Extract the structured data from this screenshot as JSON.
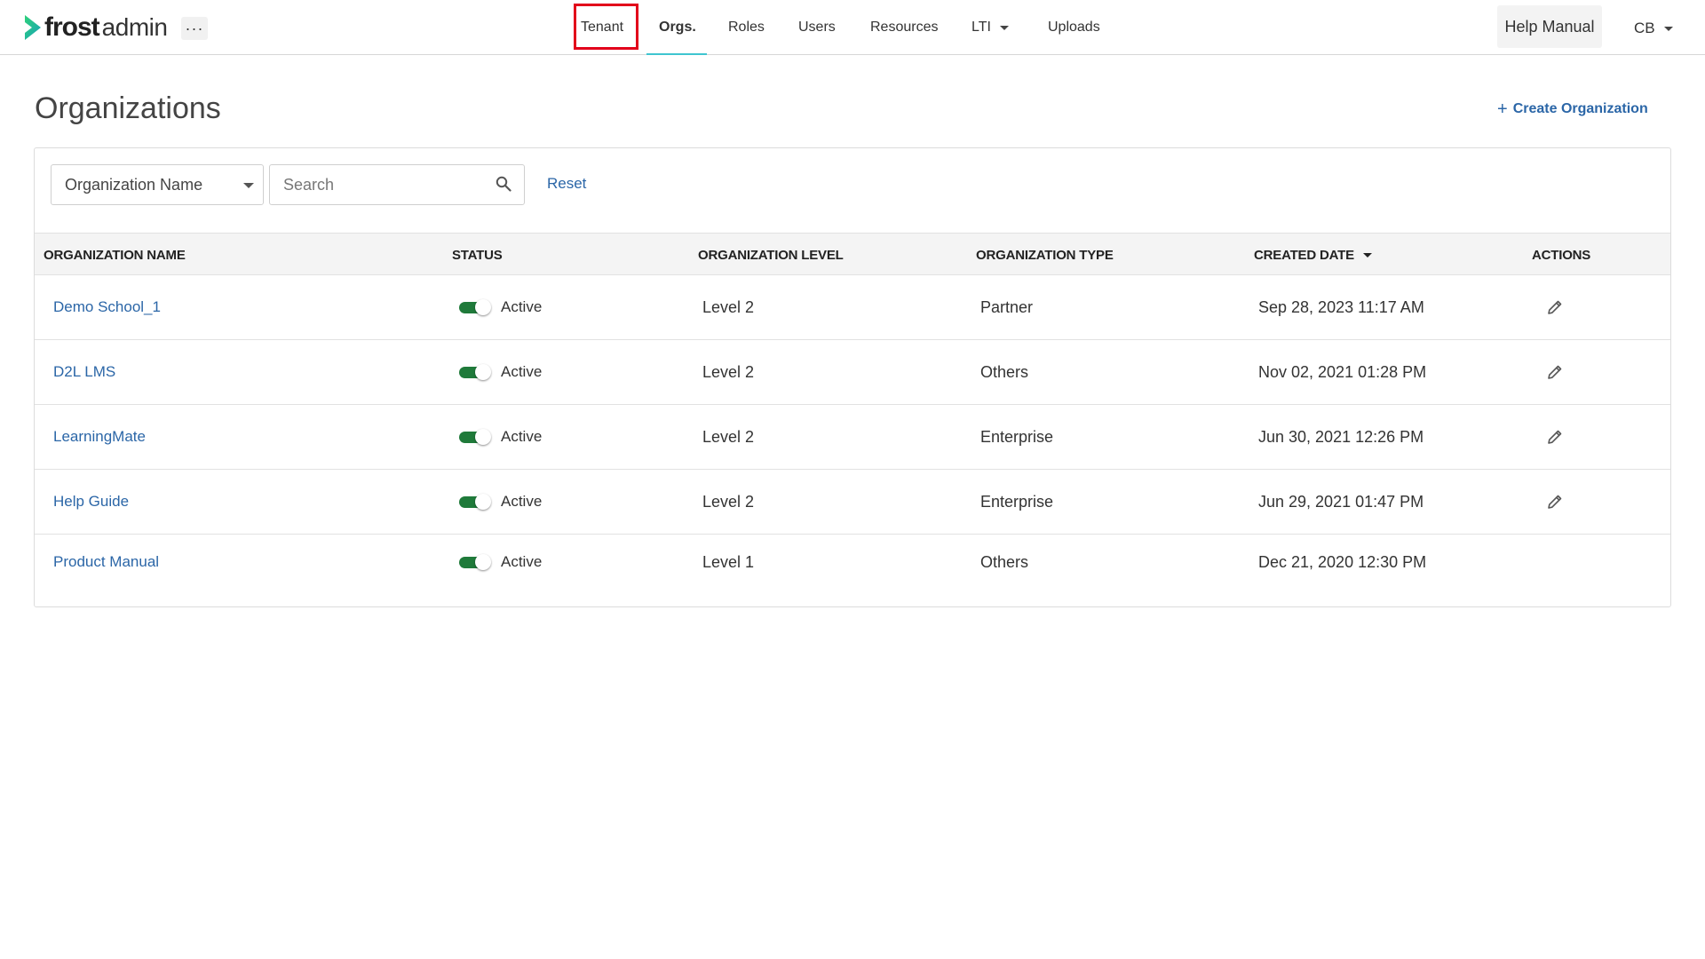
{
  "app": {
    "logo_word": "frost",
    "logo_sub": "admin",
    "more_label": "···"
  },
  "nav": {
    "items": [
      {
        "label": "Tenant"
      },
      {
        "label": "Orgs."
      },
      {
        "label": "Roles"
      },
      {
        "label": "Users"
      },
      {
        "label": "Resources"
      },
      {
        "label": "LTI"
      },
      {
        "label": "Uploads"
      }
    ],
    "active": "Orgs."
  },
  "header_right": {
    "help_label": "Help Manual",
    "user_initials": "CB"
  },
  "page": {
    "title": "Organizations",
    "create_label": "Create Organization"
  },
  "filters": {
    "field_selected": "Organization Name",
    "search_placeholder": "Search",
    "reset_label": "Reset"
  },
  "table": {
    "columns": {
      "name": "ORGANIZATION NAME",
      "status": "STATUS",
      "level": "ORGANIZATION LEVEL",
      "type": "ORGANIZATION TYPE",
      "created": "CREATED DATE",
      "actions": "ACTIONS"
    },
    "sort": {
      "column": "CREATED DATE",
      "direction": "descending"
    },
    "rows": [
      {
        "name": "Demo School_1",
        "status": "Active",
        "enabled": true,
        "level": "Level 2",
        "type": "Partner",
        "created": "Sep 28, 2023 11:17 AM",
        "editable": true
      },
      {
        "name": "D2L LMS",
        "status": "Active",
        "enabled": true,
        "level": "Level 2",
        "type": "Others",
        "created": "Nov 02, 2021 01:28 PM",
        "editable": true
      },
      {
        "name": "LearningMate",
        "status": "Active",
        "enabled": true,
        "level": "Level 2",
        "type": "Enterprise",
        "created": "Jun 30, 2021 12:26 PM",
        "editable": true
      },
      {
        "name": "Help Guide",
        "status": "Active",
        "enabled": true,
        "level": "Level 2",
        "type": "Enterprise",
        "created": "Jun 29, 2021 01:47 PM",
        "editable": true
      },
      {
        "name": "Product Manual",
        "status": "Active",
        "enabled": true,
        "level": "Level 1",
        "type": "Others",
        "created": "Dec 21, 2020 12:30 PM",
        "editable": false
      }
    ]
  },
  "colors": {
    "brand_green": "#1fb25a",
    "brand_teal": "#3fc5d0",
    "link_blue": "#2b66a7",
    "toggle_on": "#1f7a3a",
    "highlight_red": "#e2001a"
  },
  "icons": {
    "more": "ellipsis-icon",
    "search": "search-icon",
    "edit": "pencil-icon",
    "caret": "caret-down-icon",
    "plus": "plus-icon",
    "logo": "chevron-logo-icon"
  }
}
